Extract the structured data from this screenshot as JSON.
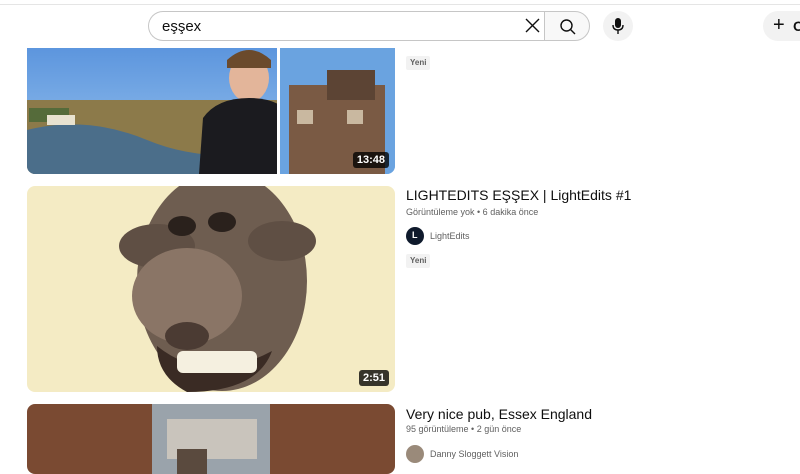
{
  "search": {
    "query": "eşşex",
    "placeholder": ""
  },
  "header": {
    "create_label": "O"
  },
  "results": [
    {
      "duration": "13:48",
      "badge": "Yeni"
    },
    {
      "title": "LIGHTEDITS EŞŞEX | LightEdits #1",
      "meta": "Görüntüleme yok • 6 dakika önce",
      "channel": "LightEdits",
      "channel_avatar_letter": "L",
      "badge": "Yeni",
      "duration": "2:51"
    },
    {
      "title": "Very nice pub, Essex England",
      "meta": "95 görüntüleme • 2 gün önce",
      "channel": "Danny Sloggett Vision"
    }
  ]
}
